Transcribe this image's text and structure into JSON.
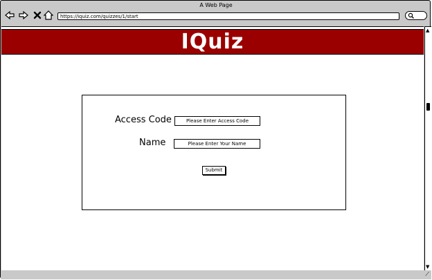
{
  "window": {
    "title": "A Web Page"
  },
  "toolbar": {
    "url": "https://iquiz.com/quizzes/1/start",
    "icons": [
      "back-icon",
      "forward-icon",
      "close-icon",
      "home-icon",
      "search-icon"
    ]
  },
  "header": {
    "title": "IQuiz",
    "color": "#9a0000"
  },
  "form": {
    "access_code_label": "Access Code",
    "access_code_placeholder": "Please Enter Access Code",
    "name_label": "Name",
    "name_placeholder": "Please Enter Your Name",
    "submit_label": "Submit"
  }
}
